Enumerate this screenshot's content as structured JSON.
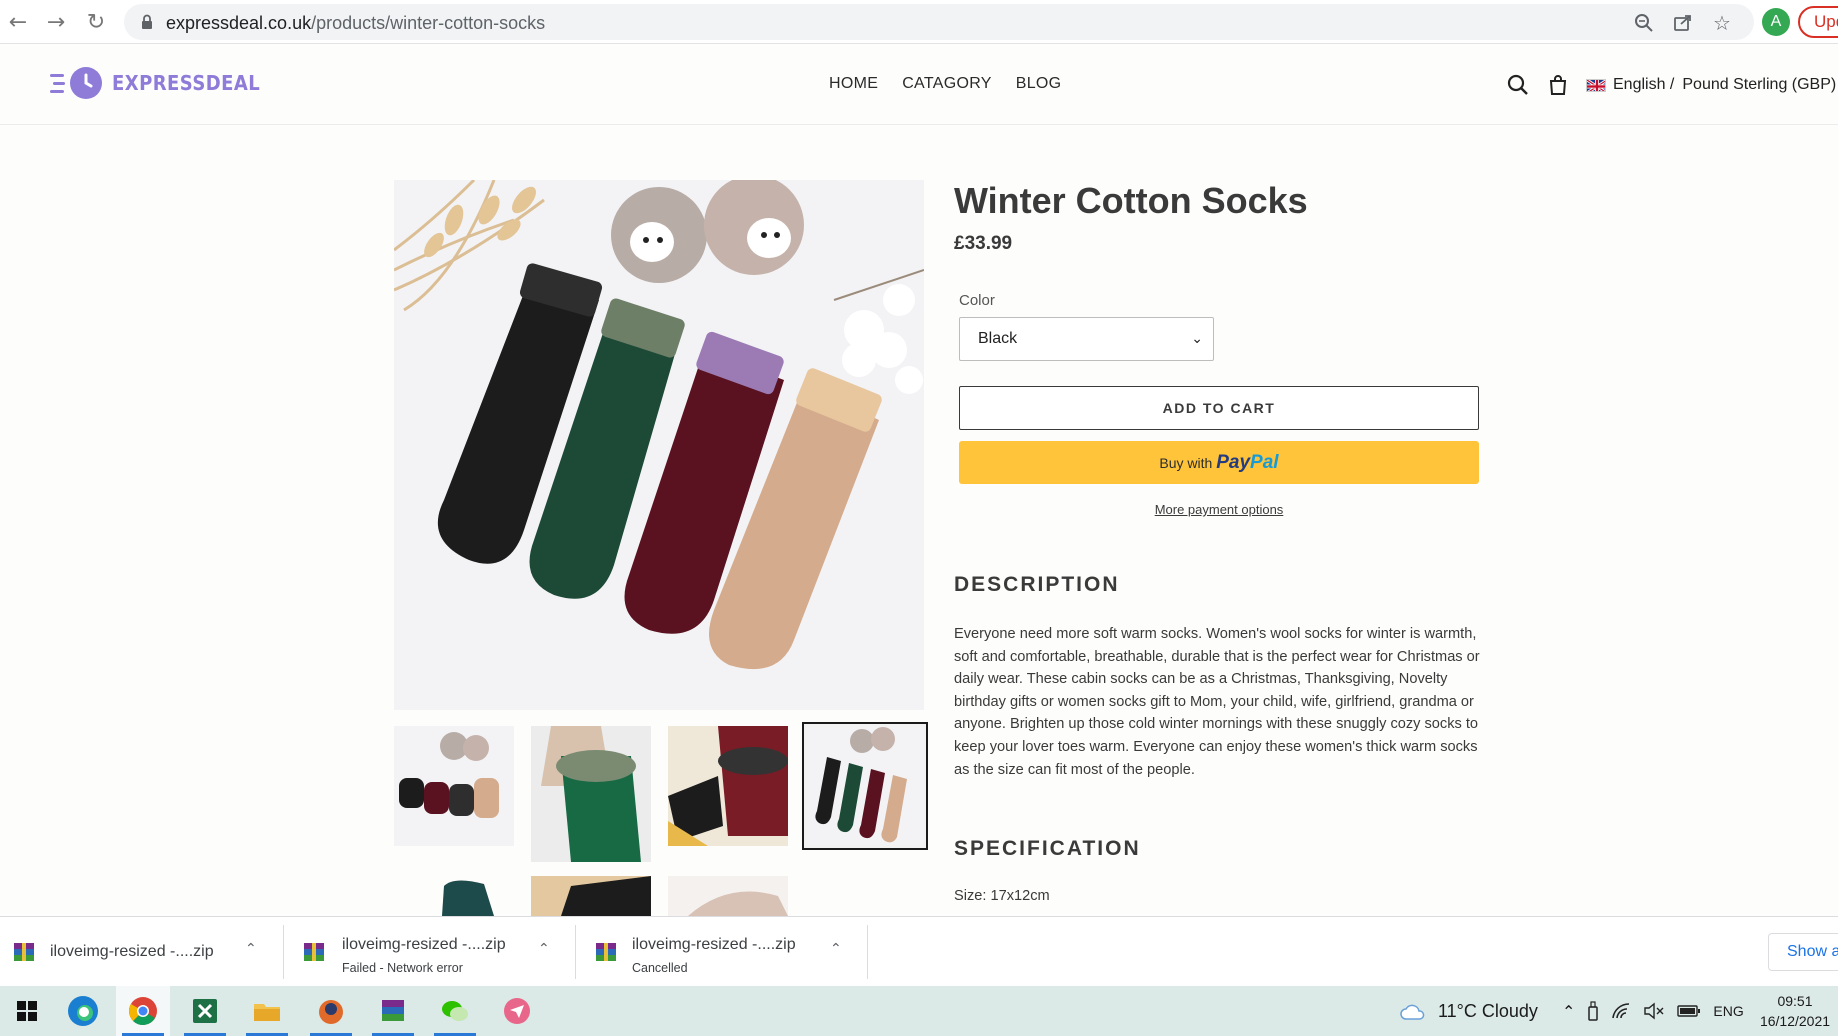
{
  "browser": {
    "url_domain": "expressdeal.co.uk",
    "url_path": "/products/winter-cotton-socks",
    "profile_initial": "A",
    "update_label": "Update"
  },
  "site": {
    "logo_text": "EXPRESSDEAL",
    "brand_color": "#8f7bd8",
    "nav": [
      "HOME",
      "CATAGORY",
      "BLOG"
    ],
    "language": "English /",
    "currency": "Pound Sterling (GBP)"
  },
  "product": {
    "title": "Winter Cotton Socks",
    "price": "£33.99",
    "color_label": "Color",
    "color_value": "Black",
    "add_to_cart": "ADD TO CART",
    "paypal_prefix": "Buy with",
    "paypal_pay": "Pay",
    "paypal_pal": "Pal",
    "more_payment": "More payment options",
    "description_heading": "DESCRIPTION",
    "description": "Everyone need more soft warm socks. Women's wool socks for winter is warmth, soft and comfortable, breathable, durable that is the perfect wear for Christmas or daily wear. These cabin socks can be as a Christmas, Thanksgiving, Novelty birthday gifts or women socks gift to Mom, your child, wife, girlfriend, grandma or anyone. Brighten up those cold winter mornings with these snuggly cozy socks to keep your lover toes warm. Everyone can enjoy these women's thick warm socks as the size can fit most of the people.",
    "specification_heading": "SPECIFICATION",
    "spec_size": "Size: 17x12cm",
    "sock_colors": [
      "#1c1c1c",
      "#1d4a36",
      "#5a1220",
      "#d4ab8c"
    ]
  },
  "downloads": [
    {
      "name": "iloveimg-resized -....zip",
      "status": ""
    },
    {
      "name": "iloveimg-resized -....zip",
      "status": "Failed - Network error"
    },
    {
      "name": "iloveimg-resized -....zip",
      "status": "Cancelled"
    }
  ],
  "downloads_show_all": "Show all",
  "taskbar": {
    "weather": "11°C  Cloudy",
    "language": "ENG",
    "time": "09:51",
    "date": "16/12/2021"
  }
}
